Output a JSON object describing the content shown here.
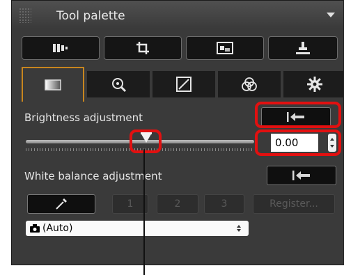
{
  "window": {
    "title": "Tool palette"
  },
  "toolbar": {
    "buttons": [
      {
        "icon": "basic-adjustment-icon"
      },
      {
        "icon": "crop-icon"
      },
      {
        "icon": "image-icon"
      },
      {
        "icon": "stamp-icon"
      }
    ]
  },
  "tabs": [
    {
      "icon": "gradient-icon",
      "active": true
    },
    {
      "icon": "lens-icon",
      "active": false
    },
    {
      "icon": "tone-curve-icon",
      "active": false
    },
    {
      "icon": "color-icon",
      "active": false
    },
    {
      "icon": "gear-icon",
      "active": false
    }
  ],
  "brightness": {
    "label": "Brightness adjustment",
    "value": "0.00",
    "slider_level": 0.5
  },
  "white_balance": {
    "label": "White balance adjustment",
    "buttons": [
      "1",
      "2",
      "3"
    ],
    "register_label": "Register...",
    "select_value": "(Auto)"
  },
  "colors": {
    "highlight": "#e21010",
    "active_tab_border": "#c8861e"
  }
}
